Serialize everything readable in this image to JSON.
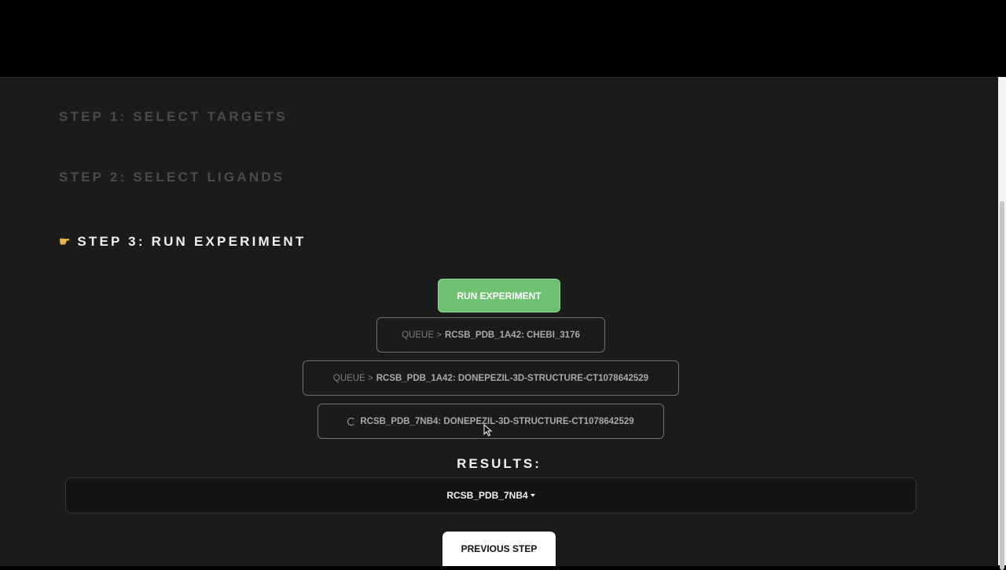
{
  "steps": {
    "step1": "STEP 1: SELECT TARGETS",
    "step2": "STEP 2: SELECT LIGANDS",
    "step3": "STEP 3: RUN EXPERIMENT",
    "step3_icon": "pointing-hand-icon"
  },
  "run_button": "RUN EXPERIMENT",
  "queue": [
    {
      "prefix": "QUEUE >",
      "name": "RCSB_PDB_1A42: CHEBI_3176",
      "status": "queued"
    },
    {
      "prefix": "QUEUE >",
      "name": "RCSB_PDB_1A42: DONEPEZIL-3D-STRUCTURE-CT1078642529",
      "status": "queued"
    },
    {
      "prefix": "",
      "name": "RCSB_PDB_7NB4: DONEPEZIL-3D-STRUCTURE-CT1078642529",
      "status": "running",
      "icon": "spinner-icon"
    }
  ],
  "results": {
    "title": "RESULTS:",
    "selected": "RCSB_PDB_7NB4"
  },
  "previous_button": "PREVIOUS STEP",
  "colors": {
    "background": "#1b1b1b",
    "run_button": "#6ec173",
    "dim_text": "#4b4b4b"
  }
}
